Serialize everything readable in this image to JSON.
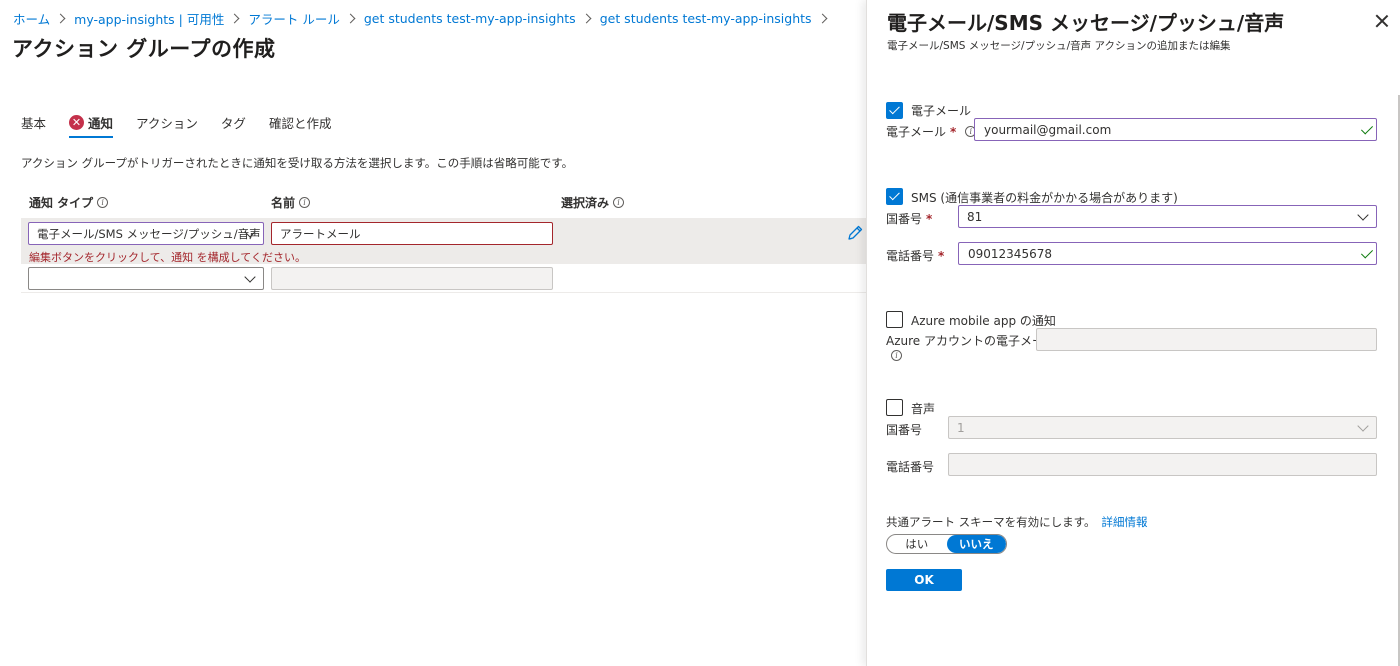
{
  "breadcrumb": [
    "ホーム",
    "my-app-insights | 可用性",
    "アラート ルール",
    "get students test-my-app-insights",
    "get students test-my-app-insights"
  ],
  "page": {
    "title": "アクション グループの作成",
    "more": "…"
  },
  "tabs": [
    {
      "label": "基本",
      "active": false,
      "error": false
    },
    {
      "label": "通知",
      "active": true,
      "error": true
    },
    {
      "label": "アクション",
      "active": false,
      "error": false
    },
    {
      "label": "タグ",
      "active": false,
      "error": false
    },
    {
      "label": "確認と作成",
      "active": false,
      "error": false
    }
  ],
  "description": "アクション グループがトリガーされたときに通知を受け取る方法を選択します。この手順は省略可能です。",
  "table": {
    "headers": {
      "type": "通知 タイプ",
      "name": "名前",
      "selected": "選択済み"
    },
    "rows": [
      {
        "type": "電子メール/SMS メッセージ/プッシュ/音声",
        "name": "アラートメール",
        "error": "編集ボタンをクリックして、通知 を構成してください。"
      },
      {
        "type": "",
        "name": ""
      }
    ]
  },
  "panel": {
    "title": "電子メール/SMS メッセージ/プッシュ/音声",
    "subtitle": "電子メール/SMS メッセージ/プッシュ/音声 アクションの追加または編集",
    "email": {
      "checkbox_label": "電子メール",
      "checked": true,
      "field_label": "電子メール",
      "value": "yourmail@gmail.com"
    },
    "sms": {
      "checkbox_label": "SMS (通信事業者の料金がかかる場合があります)",
      "checked": true,
      "country_label": "国番号",
      "country_value": "81",
      "phone_label": "電話番号",
      "phone_value": "09012345678"
    },
    "azure_app": {
      "checkbox_label": "Azure mobile app の通知",
      "checked": false,
      "field_label": "Azure アカウントの電子メール",
      "value": ""
    },
    "voice": {
      "checkbox_label": "音声",
      "checked": false,
      "country_label": "国番号",
      "country_value": "1",
      "phone_label": "電話番号",
      "phone_value": ""
    },
    "schema": {
      "label": "共通アラート スキーマを有効にします。",
      "link": "詳細情報",
      "options": [
        "はい",
        "いいえ"
      ],
      "selected": "いいえ"
    },
    "ok_label": "OK"
  },
  "colors": {
    "accent": "#0078d4",
    "error": "#a4262c",
    "valid": "#107c10",
    "focus": "#8764b8"
  }
}
